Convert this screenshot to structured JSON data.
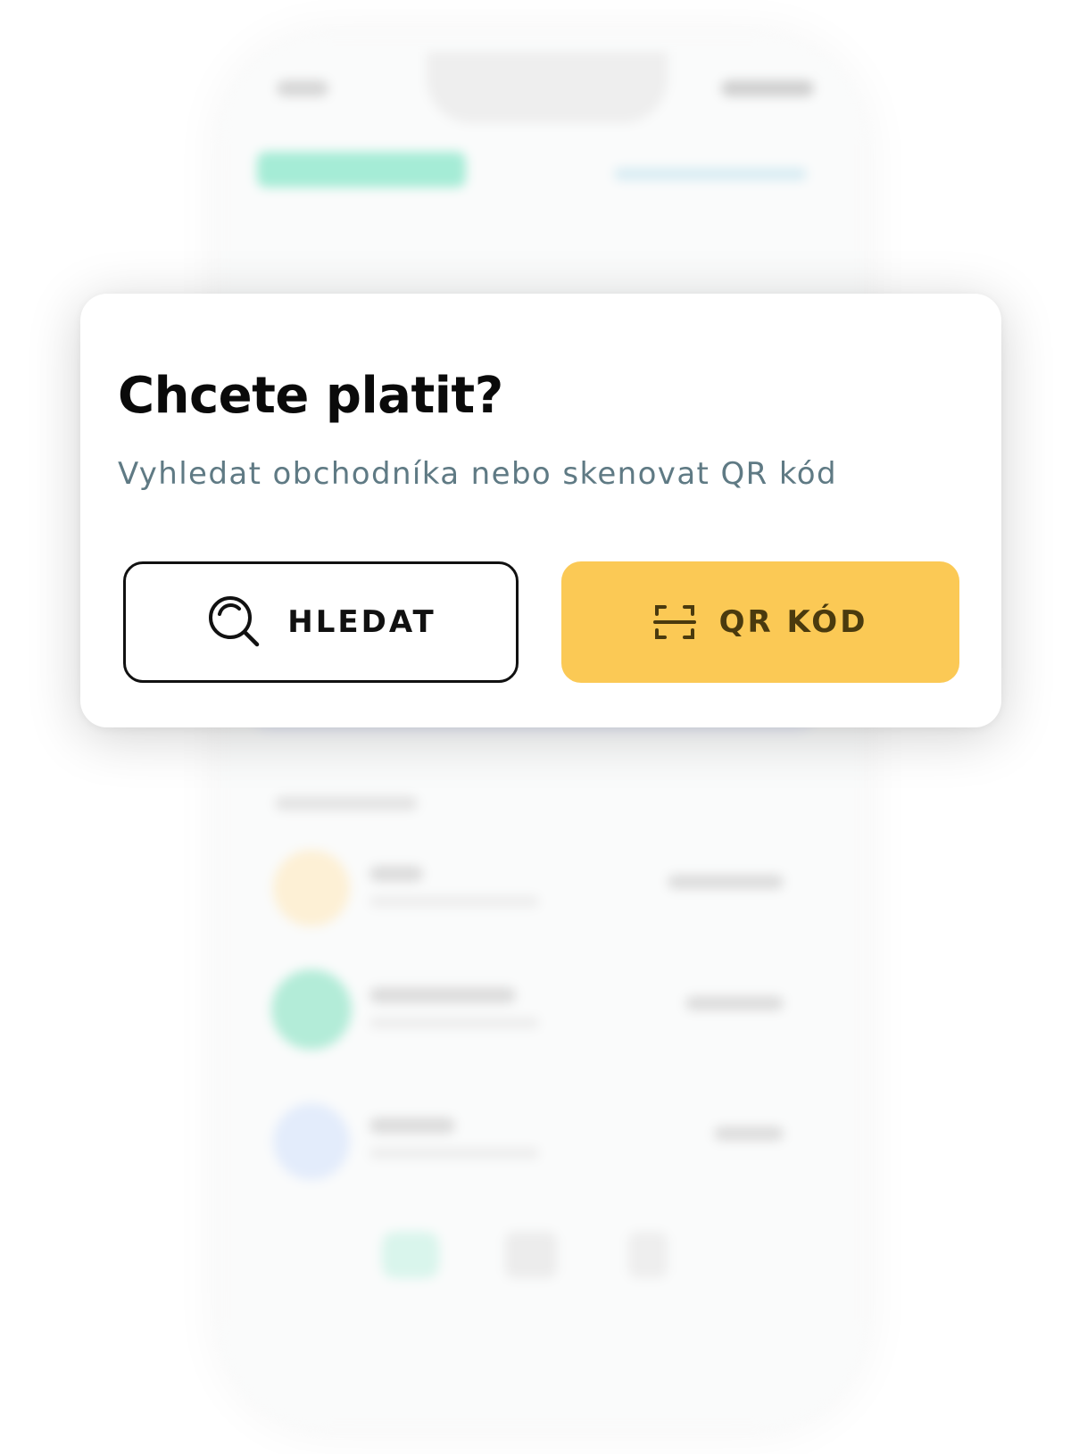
{
  "dialog": {
    "title": "Chcete platit?",
    "subtitle": "Vyhledat obchodníka nebo skenovat QR kód",
    "search_button": {
      "label": "HLEDAT",
      "icon": "search-icon"
    },
    "qr_button": {
      "label": "QR KÓD",
      "icon": "qr-scan-icon"
    }
  },
  "colors": {
    "qr_button_bg": "#fbc955",
    "subtitle": "#5f7a84",
    "title": "#0a0a0a",
    "brand_green_blurred": "#7fe0c4"
  }
}
